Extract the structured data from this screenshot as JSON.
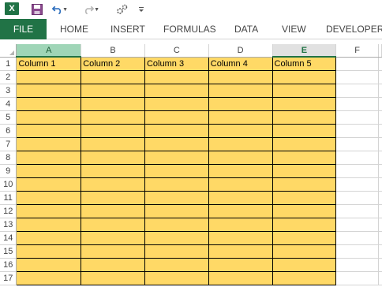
{
  "app": {
    "logo_letter": "X",
    "accent_color": "#217346",
    "table_fill_color": "#ffd966"
  },
  "qat": {
    "icons": [
      "excel-logo-icon",
      "save-icon",
      "undo-icon",
      "redo-icon",
      "macro-icon",
      "customize-qat-icon"
    ]
  },
  "ribbon": {
    "tabs": [
      {
        "label": "FILE"
      },
      {
        "label": "HOME"
      },
      {
        "label": "INSERT"
      },
      {
        "label": "FORMULAS"
      },
      {
        "label": "DATA"
      },
      {
        "label": "VIEW"
      },
      {
        "label": "DEVELOPER"
      }
    ]
  },
  "sheet": {
    "columns": [
      "A",
      "B",
      "C",
      "D",
      "E",
      "F"
    ],
    "rows": [
      "1",
      "2",
      "3",
      "4",
      "5",
      "6",
      "7",
      "8",
      "9",
      "10",
      "11",
      "12",
      "13",
      "14",
      "15",
      "16",
      "17"
    ],
    "header_row": [
      "Column 1",
      "Column 2",
      "Column 3",
      "Column 4",
      "Column 5"
    ]
  }
}
